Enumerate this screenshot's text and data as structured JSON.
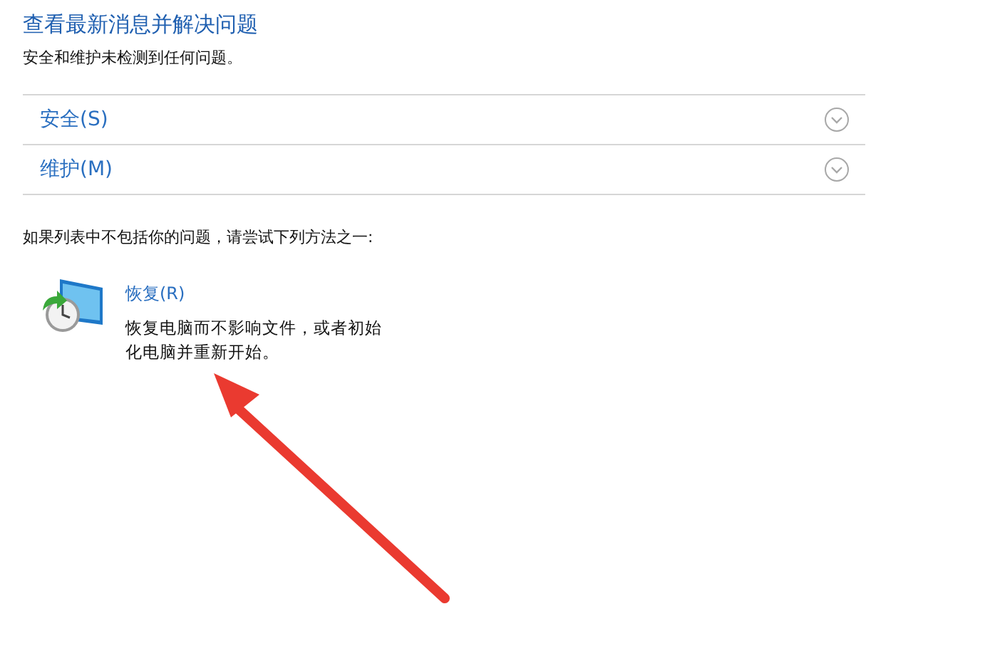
{
  "header": {
    "title": "查看最新消息并解决问题",
    "subtitle": "安全和维护未检测到任何问题。"
  },
  "sections": [
    {
      "label": "安全(S)",
      "expanded": false
    },
    {
      "label": "维护(M)",
      "expanded": false
    }
  ],
  "hint": "如果列表中不包括你的问题，请尝试下列方法之一:",
  "actions": [
    {
      "link": "恢复(R)",
      "description": "恢复电脑而不影响文件，或者初始化电脑并重新开始。"
    }
  ]
}
